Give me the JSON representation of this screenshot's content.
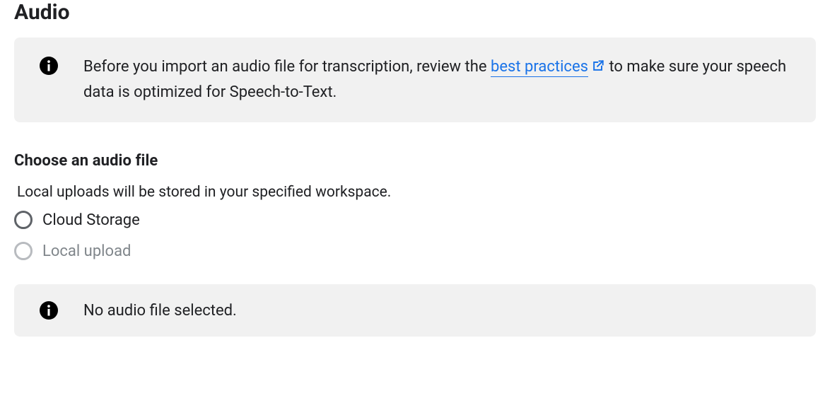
{
  "page_title": "Audio",
  "info_banner": {
    "text_before": "Before you import an audio file for transcription, review the ",
    "link_text": "best practices",
    "text_after": " to make sure your speech data is optimized for Speech-to-Text."
  },
  "choose_section": {
    "heading": "Choose an audio file",
    "hint": "Local uploads will be stored in your specified workspace.",
    "options": [
      {
        "label": "Cloud Storage",
        "enabled": true
      },
      {
        "label": "Local upload",
        "enabled": false
      }
    ]
  },
  "status_banner": {
    "text": "No audio file selected."
  }
}
